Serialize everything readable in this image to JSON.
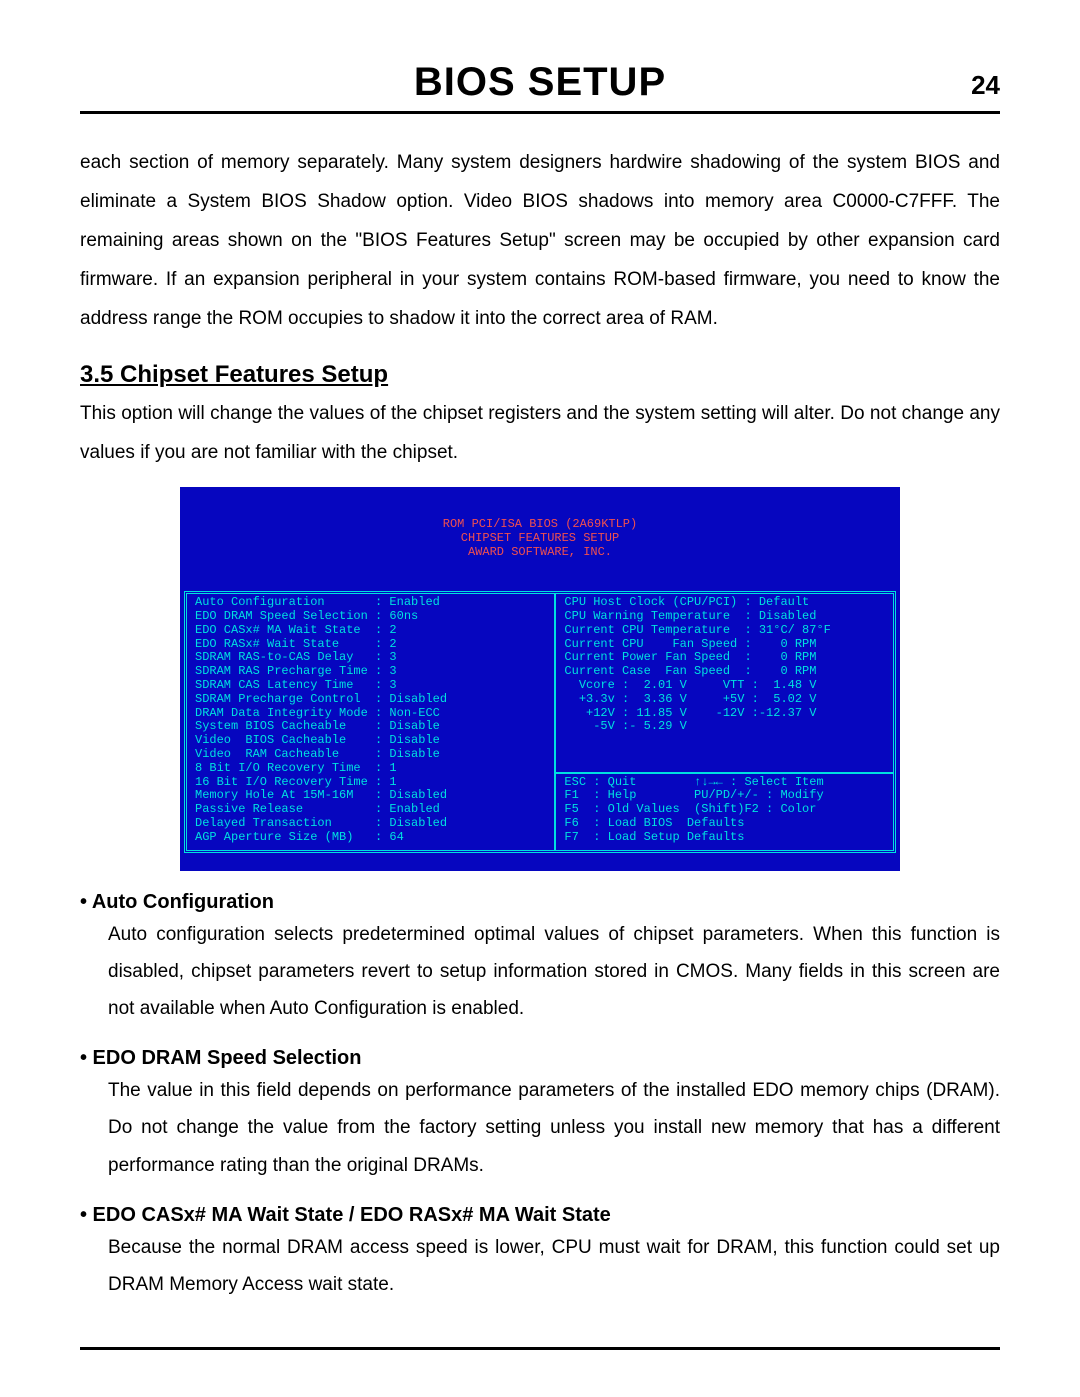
{
  "header": {
    "title": "BIOS SETUP",
    "page": "24"
  },
  "intro_para": "each section of memory separately. Many system designers hardwire shadowing of the system BIOS and eliminate a System BIOS Shadow option. Video BIOS shadows into memory area C0000-C7FFF. The remaining areas shown on the \"BIOS Features Setup\" screen may be occupied by other expansion card firmware. If an expansion peripheral in your system contains ROM-based firmware, you need to know the address range the ROM occupies to shadow it into the correct area of RAM.",
  "section": {
    "number_title": "3.5 Chipset Features Setup",
    "intro": "This option will change the values of the chipset registers and the system setting will alter.  Do not change any values if you are not familiar with the chipset."
  },
  "bios": {
    "header_l1": "ROM PCI/ISA BIOS (2A69KTLP)",
    "header_l2": "CHIPSET FEATURES SETUP",
    "header_l3": "AWARD SOFTWARE, INC.",
    "left": "Auto Configuration       : Enabled\nEDO DRAM Speed Selection : 60ns\nEDO CASx# MA Wait State  : 2\nEDO RASx# Wait State     : 2\nSDRAM RAS-to-CAS Delay   : 3\nSDRAM RAS Precharge Time : 3\nSDRAM CAS Latency Time   : 3\nSDRAM Precharge Control  : Disabled\nDRAM Data Integrity Mode : Non-ECC\nSystem BIOS Cacheable    : Disable\nVideo  BIOS Cacheable    : Disable\nVideo  RAM Cacheable     : Disable\n8 Bit I/O Recovery Time  : 1\n16 Bit I/O Recovery Time : 1\nMemory Hole At 15M-16M   : Disabled\nPassive Release          : Enabled\nDelayed Transaction      : Disabled\nAGP Aperture Size (MB)   : 64",
    "right_top": "CPU Host Clock (CPU/PCI) : Default\nCPU Warning Temperature  : Disabled\nCurrent CPU Temperature  : 31°C/ 87°F\nCurrent CPU    Fan Speed :    0 RPM\nCurrent Power Fan Speed  :    0 RPM\nCurrent Case  Fan Speed  :    0 RPM\n  Vcore :  2.01 V     VTT :  1.48 V\n  +3.3v :  3.36 V     +5V :  5.02 V\n   +12V : 11.85 V    -12V :-12.37 V\n    -5V :- 5.29 V",
    "right_bottom": "ESC : Quit        ↑↓→← : Select Item\nF1  : Help        PU/PD/+/- : Modify\nF5  : Old Values  (Shift)F2 : Color\nF6  : Load BIOS  Defaults\nF7  : Load Setup Defaults"
  },
  "items": {
    "auto_conf": {
      "title": "• Auto Configuration",
      "body": "Auto configuration selects predetermined optimal values of chipset parameters. When this function is disabled, chipset parameters revert to setup information stored in CMOS. Many fields in this screen are not available when Auto Configuration is enabled."
    },
    "edo_speed": {
      "title": "• EDO DRAM Speed Selection",
      "body": "The value in this field depends on performance parameters of the installed EDO memory chips (DRAM). Do not change the value from the factory setting unless you install new memory that has a different performance rating than the original DRAMs."
    },
    "edo_wait": {
      "title": "• EDO CASx# MA Wait State / EDO RASx# MA Wait State",
      "body": "Because the normal DRAM access speed is lower, CPU must  wait for DRAM, this function could set up DRAM Memory Access wait state."
    }
  }
}
